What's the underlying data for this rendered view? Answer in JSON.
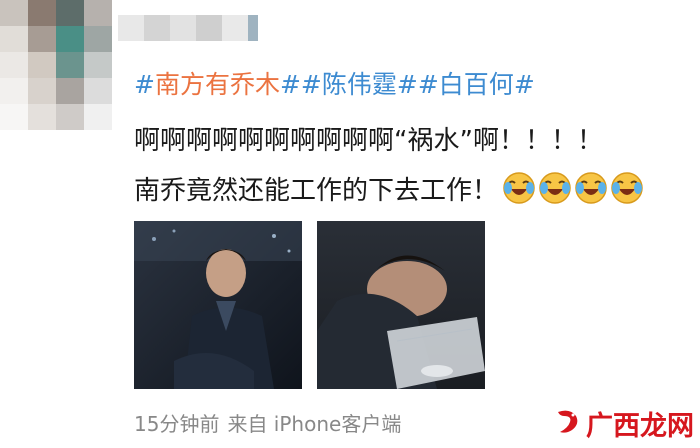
{
  "post": {
    "topics": [
      {
        "open": "#",
        "text": "南方有乔木",
        "close": "#",
        "style": "topic"
      },
      {
        "open": "#",
        "text": "陈伟霆",
        "close": "#",
        "style": "topic-link"
      },
      {
        "open": "#",
        "text": "白百何",
        "close": "#",
        "style": "topic-link"
      }
    ],
    "line1": "啊啊啊啊啊啊啊啊啊啊“祸水”啊！！！！",
    "line2": "南乔竟然还能工作的下去工作！",
    "emoji_name": "laugh-cry-icon",
    "emoji_count": 4,
    "footer_time": "15分钟前",
    "footer_source": "来自 iPhone客户端"
  },
  "watermark": {
    "text": "广西龙网"
  },
  "colors": {
    "topic_orange": "#eb7340",
    "topic_blue": "#3d8bd1",
    "text": "#1a1a1a",
    "footer": "#888888",
    "watermark_red": "#d6171e"
  }
}
